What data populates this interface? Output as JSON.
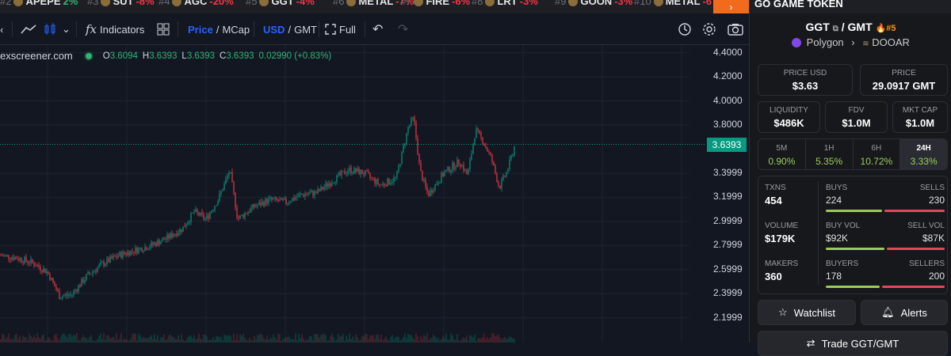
{
  "ticker": [
    {
      "rank": "#2",
      "symbol": "APEPE",
      "change": "2%",
      "positive": true
    },
    {
      "rank": "#3",
      "symbol": "SUT",
      "change": "-8%",
      "positive": false
    },
    {
      "rank": "#4",
      "symbol": "AGC",
      "change": "-20%",
      "positive": false
    },
    {
      "rank": "#5",
      "symbol": "GGT",
      "change": "-4%",
      "positive": false
    },
    {
      "rank": "#6",
      "symbol": "METAL",
      "change": "-7%",
      "positive": false
    },
    {
      "rank": "#7",
      "symbol": "FIRE",
      "change": "-6%",
      "positive": false
    },
    {
      "rank": "#8",
      "symbol": "LRT",
      "change": "-3%",
      "positive": false
    },
    {
      "rank": "#9",
      "symbol": "GOON",
      "change": "-3%",
      "positive": false
    },
    {
      "rank": "#10",
      "symbol": "METAL",
      "change": "-6",
      "positive": false
    }
  ],
  "toolbar": {
    "indicators": "Indicators",
    "price": "Price",
    "mcap": "MCap",
    "usd": "USD",
    "gmt": "GMT",
    "full": "Full"
  },
  "legend": {
    "site": "exscreener.com",
    "o_label": "O",
    "o": "3.6094",
    "h_label": "H",
    "h": "3.6393",
    "l_label": "L",
    "l": "3.6393",
    "c_label": "C",
    "c": "3.6393",
    "change": "0.02990 (+0.83%)"
  },
  "chart_data": {
    "type": "line",
    "title": "",
    "price_tag": "3.6393",
    "ylim": [
      2.1,
      4.45
    ],
    "yticks": [
      "4.4000",
      "4.2000",
      "4.0000",
      "3.8000",
      "3.3999",
      "3.1999",
      "2.9999",
      "2.7999",
      "2.5999",
      "2.3999",
      "2.1999"
    ],
    "ytick_values": [
      4.4,
      4.2,
      4.0,
      3.8,
      3.4,
      3.2,
      3.0,
      2.8,
      2.6,
      2.4,
      2.2
    ],
    "x": [
      0,
      20,
      40,
      60,
      75,
      90,
      110,
      130,
      150,
      170,
      190,
      210,
      230,
      245,
      260,
      275,
      290,
      300,
      320,
      340,
      360,
      380,
      400,
      420,
      440,
      460,
      480,
      500,
      515,
      522,
      530,
      540,
      560,
      580,
      590,
      600,
      610,
      620,
      630,
      640,
      650
    ],
    "values": [
      2.72,
      2.7,
      2.66,
      2.58,
      2.38,
      2.39,
      2.55,
      2.65,
      2.72,
      2.76,
      2.8,
      2.86,
      2.94,
      3.08,
      3.02,
      3.18,
      3.42,
      3.02,
      3.12,
      3.18,
      3.16,
      3.22,
      3.24,
      3.34,
      3.43,
      3.4,
      3.3,
      3.36,
      3.78,
      3.86,
      3.42,
      3.22,
      3.4,
      3.5,
      3.38,
      3.76,
      3.66,
      3.52,
      3.28,
      3.42,
      3.64
    ]
  },
  "panel": {
    "token_name": "GO GAME TOKEN",
    "base": "GGT",
    "quote": "GMT",
    "rank": "#5",
    "chain": "Polygon",
    "dex": "DOOAR",
    "price_usd_label": "PRICE USD",
    "price_usd": "$3.63",
    "price_label": "PRICE",
    "price": "29.0917 GMT",
    "liquidity_label": "LIQUIDITY",
    "liquidity": "$486K",
    "fdv_label": "FDV",
    "fdv": "$1.0M",
    "mktcap_label": "MKT CAP",
    "mktcap": "$1.0M",
    "timeframes": [
      {
        "t": "5M",
        "p": "0.90%"
      },
      {
        "t": "1H",
        "p": "5.35%"
      },
      {
        "t": "6H",
        "p": "10.72%"
      },
      {
        "t": "24H",
        "p": "3.33%"
      }
    ],
    "stats": [
      {
        "l": "TXNS",
        "v": "454",
        "bl": "BUYS",
        "bv": "224",
        "sl": "SELLS",
        "sv": "230",
        "buy_frac": 0.49
      },
      {
        "l": "VOLUME",
        "v": "$179K",
        "bl": "BUY VOL",
        "bv": "$92K",
        "sl": "SELL VOL",
        "sv": "$87K",
        "buy_frac": 0.51
      },
      {
        "l": "MAKERS",
        "v": "360",
        "bl": "BUYERS",
        "bv": "178",
        "sl": "SELLERS",
        "sv": "200",
        "buy_frac": 0.47
      }
    ],
    "watchlist": "Watchlist",
    "alerts": "Alerts",
    "trade": "Trade GGT/GMT"
  },
  "colors": {
    "up": "#089981",
    "down": "#f23645",
    "accent": "#2962ff",
    "orange": "#f26b1d"
  }
}
